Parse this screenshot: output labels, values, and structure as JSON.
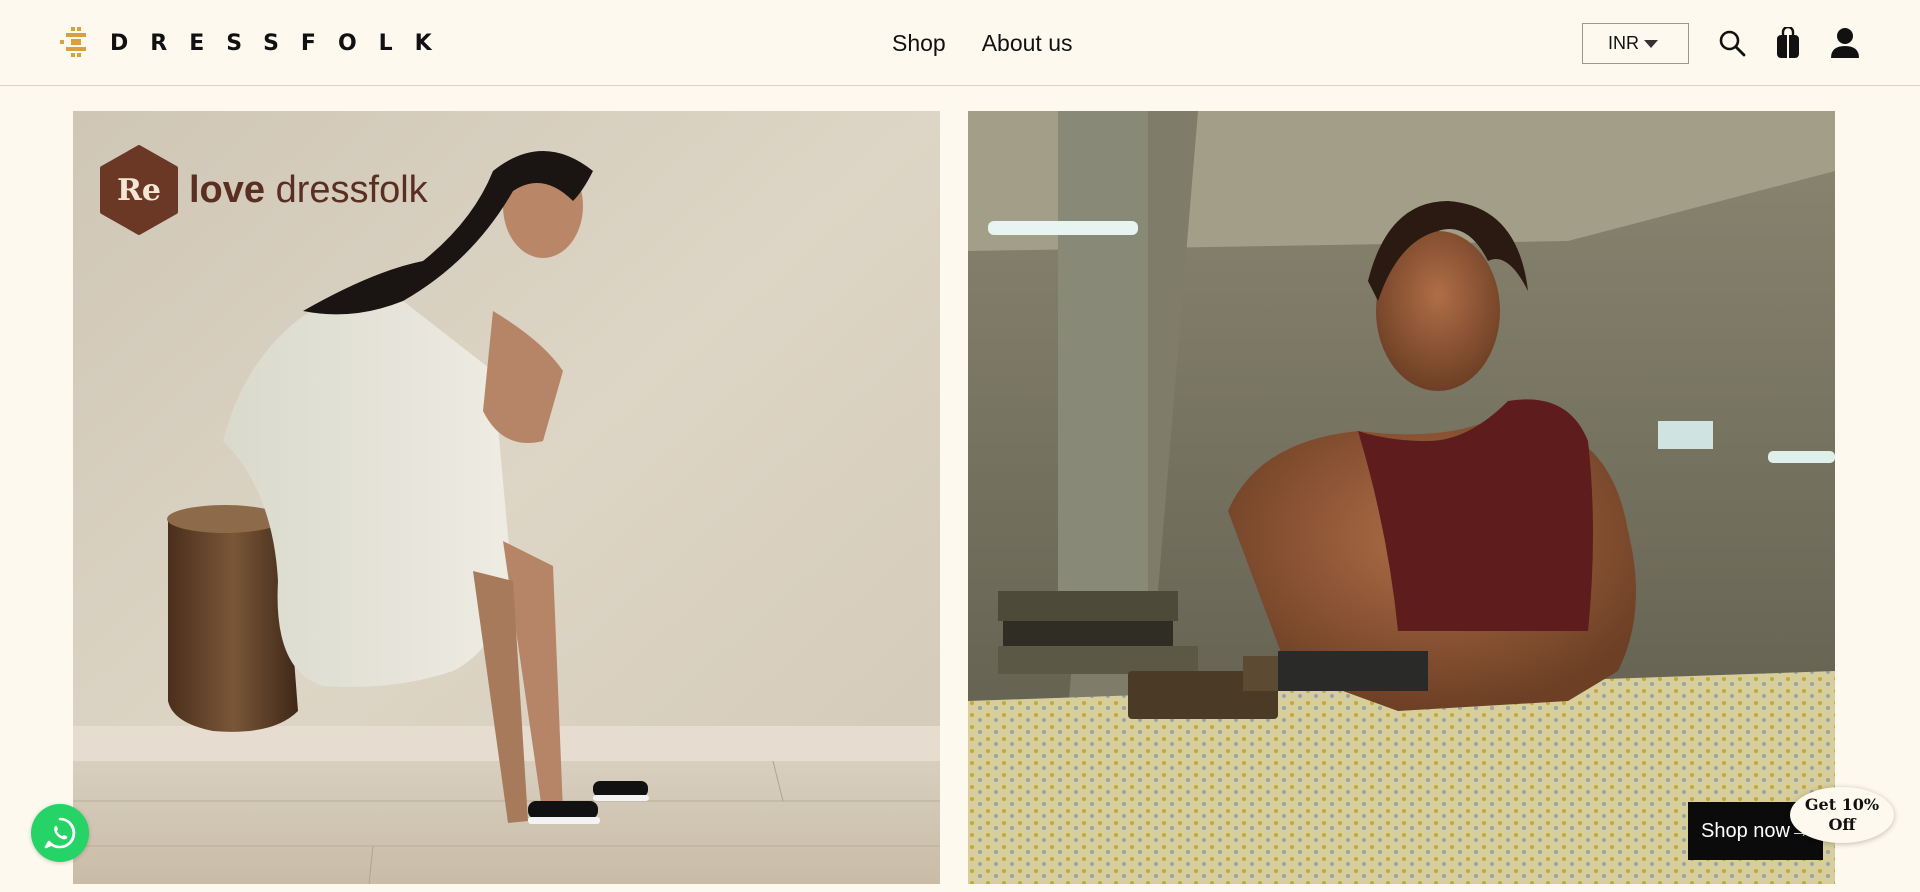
{
  "brand": {
    "name": "DRESSFOLK",
    "mark_color": "#D9A13B"
  },
  "nav": {
    "items": [
      {
        "label": "Shop"
      },
      {
        "label": "About us"
      }
    ]
  },
  "header": {
    "currency": "INR",
    "icons": [
      "search-icon",
      "shopping-bag-icon",
      "account-icon"
    ]
  },
  "hero": {
    "left_panel": {
      "badge_letters": "Re",
      "badge_text_bold": "love",
      "badge_text": " dressfolk",
      "badge_color": "#6B3826"
    },
    "right_panel": {
      "cta_label": "Shop now→"
    }
  },
  "floating": {
    "whatsapp_color": "#25D366",
    "discount_line1": "Get 10%",
    "discount_line2": "Off"
  }
}
